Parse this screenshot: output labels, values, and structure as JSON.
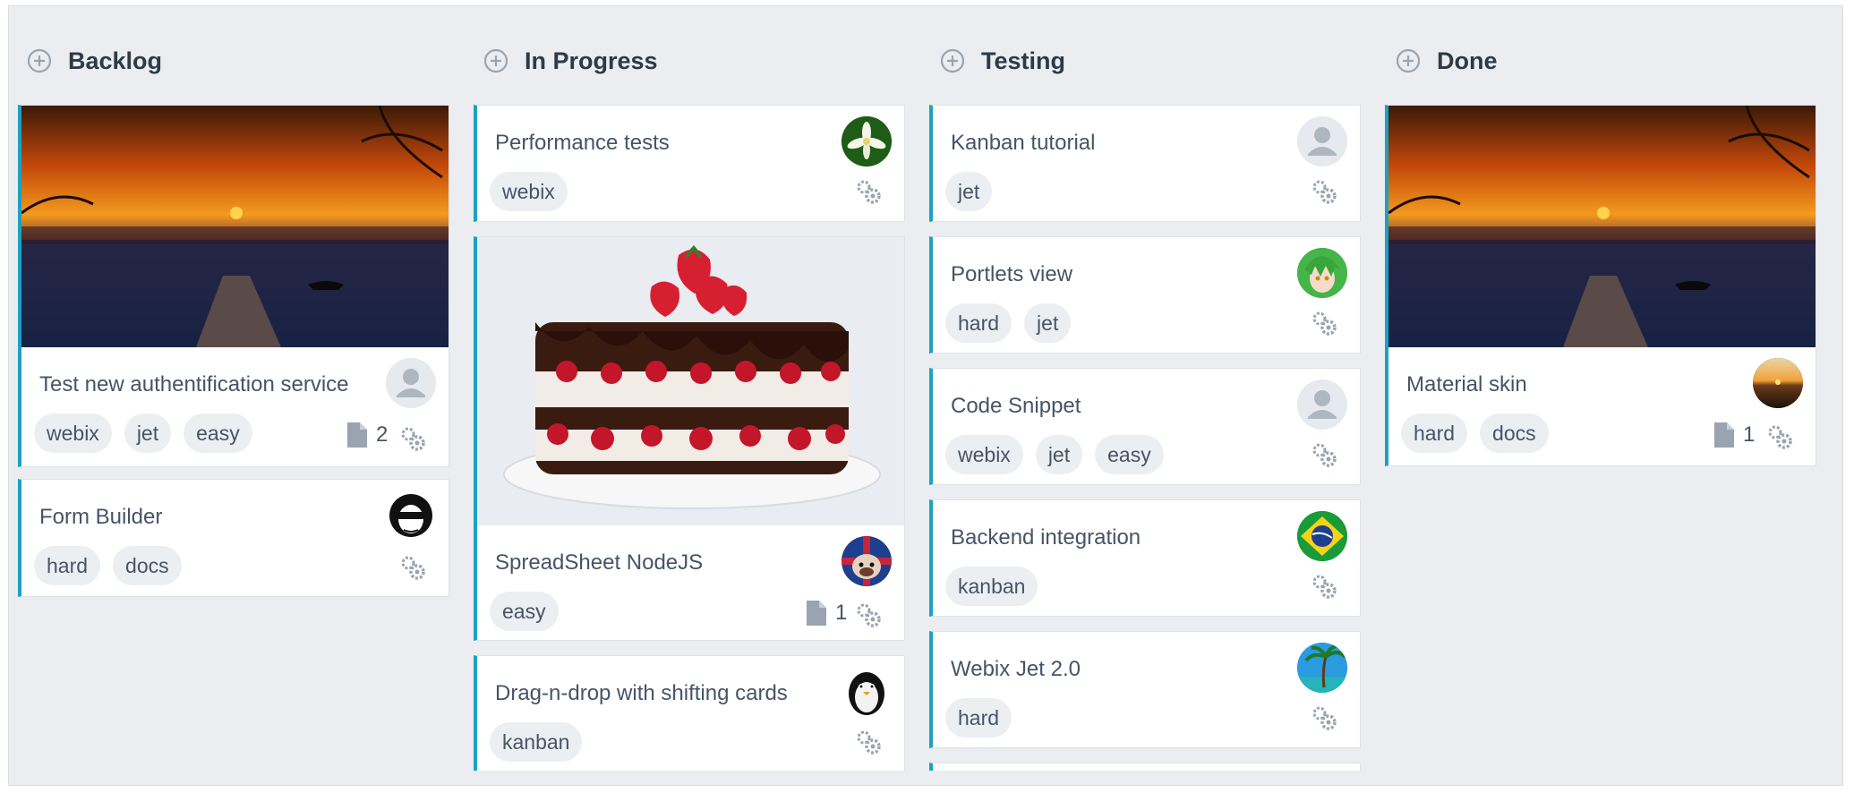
{
  "columns": [
    {
      "title": "Backlog",
      "cards": [
        {
          "title": "Test new authentification service",
          "tags": [
            "webix",
            "jet",
            "easy"
          ],
          "attachments": "2",
          "image": "sunset",
          "avatar": "default"
        },
        {
          "title": "Form Builder",
          "tags": [
            "hard",
            "docs"
          ],
          "avatar": "sunglasses"
        }
      ]
    },
    {
      "title": "In Progress",
      "cards": [
        {
          "title": "Performance tests",
          "tags": [
            "webix"
          ],
          "avatar": "flower"
        },
        {
          "title": "SpreadSheet NodeJS",
          "tags": [
            "easy"
          ],
          "attachments": "1",
          "image": "cake",
          "avatar": "bulldog"
        },
        {
          "title": "Drag-n-drop with shifting cards",
          "tags": [
            "kanban"
          ],
          "avatar": "penguin"
        }
      ]
    },
    {
      "title": "Testing",
      "cards": [
        {
          "title": "Kanban tutorial",
          "tags": [
            "jet"
          ],
          "avatar": "default"
        },
        {
          "title": "Portlets view",
          "tags": [
            "hard",
            "jet"
          ],
          "avatar": "anime"
        },
        {
          "title": "Code Snippet",
          "tags": [
            "webix",
            "jet",
            "easy"
          ],
          "avatar": "default"
        },
        {
          "title": "Backend integration",
          "tags": [
            "kanban"
          ],
          "avatar": "brazil-flag"
        },
        {
          "title": "Webix Jet 2.0",
          "tags": [
            "hard"
          ],
          "avatar": "palm-tree"
        }
      ]
    },
    {
      "title": "Done",
      "cards": [
        {
          "title": "Material skin",
          "tags": [
            "hard",
            "docs"
          ],
          "attachments": "1",
          "image": "sunset",
          "avatar": "sunset-photo"
        }
      ]
    }
  ],
  "colors": {
    "accent": "#1ca1c1",
    "background": "#ebedf0",
    "card": "#ffffff",
    "tag": "#eceff2",
    "text": "#475466"
  },
  "icons": {
    "add": "plus-circle-icon",
    "gear": "gears-icon",
    "attachment": "file-icon",
    "avatar_default": "user-icon"
  }
}
